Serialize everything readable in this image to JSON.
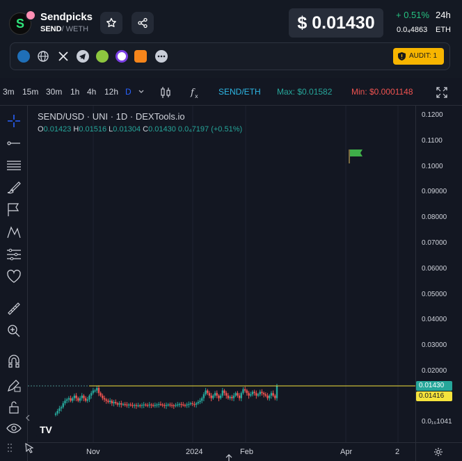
{
  "header": {
    "name": "Sendpicks",
    "base_symbol": "SEND",
    "quote_symbol": "/ WETH",
    "price": "$ 0.01430",
    "change": "+ 0.51%",
    "period": "24h",
    "eth_price": "0.0₄4863",
    "eth_label": "ETH",
    "audit_label": "AUDIT: 1",
    "colors": {
      "up": "#26c281",
      "audit": "#f7b500"
    }
  },
  "socials": [
    "dextools-icon",
    "globe-icon",
    "x-icon",
    "telegram-icon",
    "coingecko-icon",
    "coinmarketcap-icon",
    "metamask-icon",
    "more-icon"
  ],
  "toolbar": {
    "timeframes": [
      "3m",
      "15m",
      "30m",
      "1h",
      "4h",
      "12h",
      "D"
    ],
    "active_timeframe": "D",
    "pair": "SEND/ETH",
    "max": "Max: $0.01582",
    "min": "Min: $0.0001148"
  },
  "chart_data": {
    "type": "candlestick",
    "title": "SEND/USD · UNI · 1D · DEXTools.io",
    "ohlc_legend": {
      "o_label": "O",
      "o": "0.01423",
      "h_label": "H",
      "h": "0.01516",
      "l_label": "L",
      "l": "0.01304",
      "c_label": "C",
      "c": "0.01430",
      "chg": "0.0₄7197 (+0.51%)"
    },
    "y_ticks": [
      "0.1200",
      "0.1100",
      "0.1000",
      "0.09000",
      "0.08000",
      "0.07000",
      "0.06000",
      "0.05000",
      "0.04000",
      "0.03000",
      "0.02000",
      "0.0₁₆1041"
    ],
    "y_tick_values": [
      0.12,
      0.11,
      0.1,
      0.09,
      0.08,
      0.07,
      0.06,
      0.05,
      0.04,
      0.03,
      0.02
    ],
    "x_ticks": [
      "Nov",
      "2024",
      "Feb",
      "Apr",
      "2"
    ],
    "last_price": "0.01430",
    "secondary_price": "0.01416",
    "colors": {
      "up": "#26a69a",
      "down": "#ef5350",
      "last_line": "#f5e33c"
    },
    "closes": [
      0.0035,
      0.0045,
      0.0055,
      0.006,
      0.0075,
      0.0085,
      0.009,
      0.0095,
      0.0085,
      0.0095,
      0.0105,
      0.0095,
      0.0085,
      0.0095,
      0.0105,
      0.0095,
      0.0085,
      0.009,
      0.0105,
      0.0115,
      0.0125,
      0.0125,
      0.0135,
      0.0115,
      0.0105,
      0.0095,
      0.009,
      0.0085,
      0.008,
      0.0085,
      0.0075,
      0.008,
      0.0075,
      0.007,
      0.0075,
      0.007,
      0.0072,
      0.007,
      0.0068,
      0.007,
      0.0068,
      0.0065,
      0.0068,
      0.0065,
      0.0067,
      0.0065,
      0.0068,
      0.007,
      0.0068,
      0.0067,
      0.007,
      0.0068,
      0.0065,
      0.0068,
      0.007,
      0.0072,
      0.007,
      0.0068,
      0.0065,
      0.0068,
      0.007,
      0.0068,
      0.0067,
      0.0065,
      0.0068,
      0.007,
      0.0072,
      0.007,
      0.0068,
      0.0067,
      0.007,
      0.0072,
      0.0075,
      0.0072,
      0.007,
      0.0075,
      0.008,
      0.0085,
      0.0095,
      0.011,
      0.0125,
      0.0115,
      0.0105,
      0.0095,
      0.0105,
      0.0115,
      0.0105,
      0.0095,
      0.0105,
      0.0125,
      0.0115,
      0.0105,
      0.0095,
      0.01,
      0.0095,
      0.0105,
      0.0115,
      0.0105,
      0.0095,
      0.0115,
      0.013,
      0.0125,
      0.0115,
      0.0105,
      0.011,
      0.012,
      0.0115,
      0.0105,
      0.011,
      0.012,
      0.0115,
      0.011,
      0.0105,
      0.0095,
      0.0105,
      0.0115,
      0.0105,
      0.0095,
      0.0143
    ]
  }
}
